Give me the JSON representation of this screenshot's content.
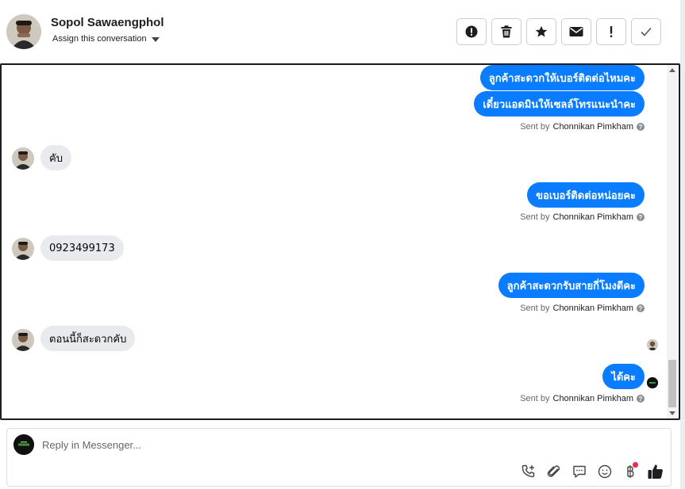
{
  "contact": {
    "name": "Sopol Sawaengphol",
    "assign_label": "Assign this conversation"
  },
  "header_actions": [
    {
      "icon": "spam-alert-icon"
    },
    {
      "icon": "trash-icon"
    },
    {
      "icon": "star-icon"
    },
    {
      "icon": "envelope-icon"
    },
    {
      "icon": "exclamation-icon"
    },
    {
      "icon": "check-icon"
    }
  ],
  "messages": [
    {
      "dir": "out",
      "text": "ลูกค้าสะดวกให้เบอร์ติดต่อไหมคะ"
    },
    {
      "dir": "out",
      "text": "เดี๋ยวแอดมินให้เซลล์โทรแนะนำคะ"
    },
    {
      "dir": "sent_by",
      "prefix": "Sent by",
      "agent": "Chonnikan Pimkham"
    },
    {
      "dir": "in",
      "text": "คับ"
    },
    {
      "dir": "out",
      "text": "ขอเบอร์ติดต่อหน่อยคะ"
    },
    {
      "dir": "sent_by",
      "prefix": "Sent by",
      "agent": "Chonnikan Pimkham"
    },
    {
      "dir": "in",
      "text": "0923499173"
    },
    {
      "dir": "out",
      "text": "ลูกค้าสะดวกรับสายกี่โมงดีคะ"
    },
    {
      "dir": "sent_by",
      "prefix": "Sent by",
      "agent": "Chonnikan Pimkham"
    },
    {
      "dir": "in",
      "text": "ตอนนี้ก็สะดวกคับ"
    },
    {
      "dir": "out",
      "text": "ได้คะ"
    },
    {
      "dir": "sent_by",
      "prefix": "Sent by",
      "agent": "Chonnikan Pimkham"
    }
  ],
  "composer": {
    "placeholder": "Reply in Messenger...",
    "tools": [
      "phone-add-icon",
      "attachment-icon",
      "saved-reply-icon",
      "emoji-icon",
      "baht-payment-icon",
      "thumbs-up-icon"
    ]
  },
  "colors": {
    "outgoing_bubble": "#0a7cff",
    "incoming_bubble": "#e9eaed",
    "notification_dot": "#f02849"
  }
}
